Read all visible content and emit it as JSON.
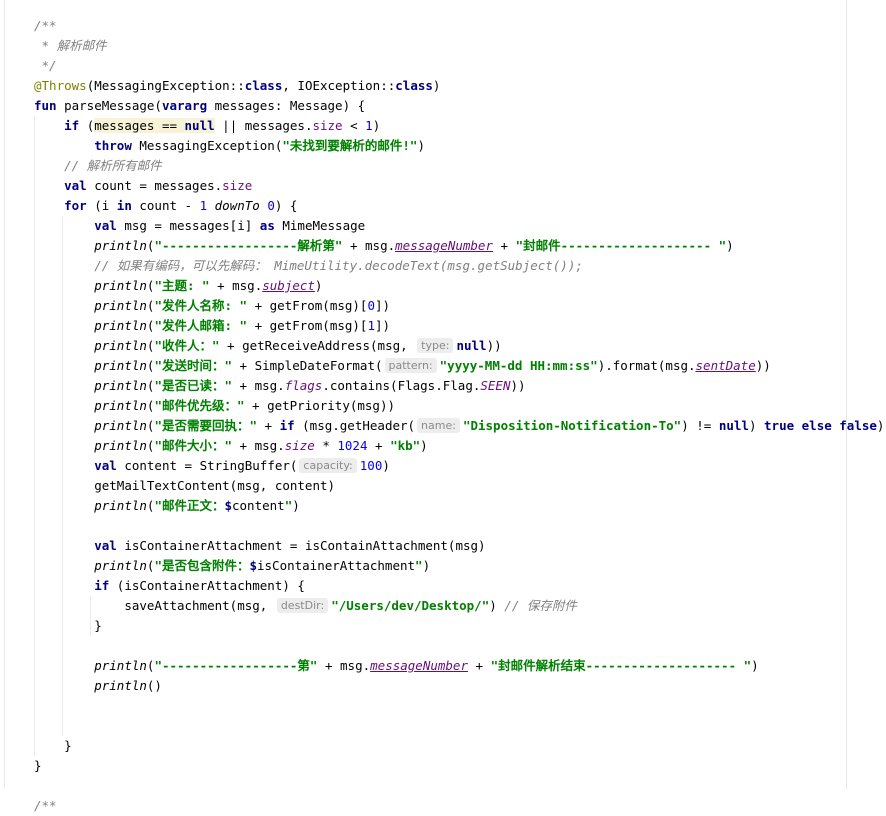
{
  "editor": {
    "lines": [
      [
        {
          "t": "/**",
          "c": "cm"
        }
      ],
      [
        {
          "t": " * 解析邮件",
          "c": "cm"
        }
      ],
      [
        {
          "t": " */",
          "c": "cm"
        }
      ],
      [
        {
          "t": "@Throws",
          "c": "ann"
        },
        {
          "t": "(MessagingException::"
        },
        {
          "t": "class",
          "c": "kw"
        },
        {
          "t": ", IOException::"
        },
        {
          "t": "class",
          "c": "kw"
        },
        {
          "t": ")"
        }
      ],
      [
        {
          "t": "fun ",
          "c": "kw"
        },
        {
          "t": "parseMessage("
        },
        {
          "t": "vararg ",
          "c": "kw"
        },
        {
          "t": "messages: Message) {"
        }
      ],
      [
        {
          "t": "    "
        },
        {
          "t": "if ",
          "c": "kw"
        },
        {
          "t": "("
        },
        {
          "t": "messages == ",
          "c": "hl"
        },
        {
          "t": "null",
          "c": "kw hl"
        },
        {
          "t": " || messages."
        },
        {
          "t": "size",
          "c": "prop"
        },
        {
          "t": " < "
        },
        {
          "t": "1",
          "c": "num"
        },
        {
          "t": ")"
        }
      ],
      [
        {
          "t": "        "
        },
        {
          "t": "throw ",
          "c": "kw"
        },
        {
          "t": "MessagingException("
        },
        {
          "t": "\"未找到要解析的邮件!\"",
          "c": "str"
        },
        {
          "t": ")"
        }
      ],
      [
        {
          "t": "    "
        },
        {
          "t": "// 解析所有邮件",
          "c": "cm"
        }
      ],
      [
        {
          "t": "    "
        },
        {
          "t": "val ",
          "c": "kw"
        },
        {
          "t": "count = messages."
        },
        {
          "t": "size",
          "c": "prop"
        }
      ],
      [
        {
          "t": "    "
        },
        {
          "t": "for ",
          "c": "kw"
        },
        {
          "t": "(i "
        },
        {
          "t": "in ",
          "c": "kw"
        },
        {
          "t": "count - "
        },
        {
          "t": "1",
          "c": "num"
        },
        {
          "t": " "
        },
        {
          "t": "downTo",
          "c": "it"
        },
        {
          "t": " "
        },
        {
          "t": "0",
          "c": "num"
        },
        {
          "t": ") {"
        }
      ],
      [
        {
          "t": "        "
        },
        {
          "t": "val ",
          "c": "kw"
        },
        {
          "t": "msg = messages[i] "
        },
        {
          "t": "as ",
          "c": "kw"
        },
        {
          "t": "MimeMessage"
        }
      ],
      [
        {
          "t": "        "
        },
        {
          "t": "println",
          "c": "it"
        },
        {
          "t": "("
        },
        {
          "t": "\"------------------解析第\"",
          "c": "str"
        },
        {
          "t": " + msg."
        },
        {
          "t": "messageNumber",
          "c": "propu"
        },
        {
          "t": " + "
        },
        {
          "t": "\"封邮件-------------------- \"",
          "c": "str"
        },
        {
          "t": ")"
        }
      ],
      [
        {
          "t": "        "
        },
        {
          "t": "// 如果有编码，可以先解码： MimeUtility.decodeText(msg.getSubject());",
          "c": "cm"
        }
      ],
      [
        {
          "t": "        "
        },
        {
          "t": "println",
          "c": "it"
        },
        {
          "t": "("
        },
        {
          "t": "\"主题: \"",
          "c": "str"
        },
        {
          "t": " + msg."
        },
        {
          "t": "subject",
          "c": "propu"
        },
        {
          "t": ")"
        }
      ],
      [
        {
          "t": "        "
        },
        {
          "t": "println",
          "c": "it"
        },
        {
          "t": "("
        },
        {
          "t": "\"发件人名称: \"",
          "c": "str"
        },
        {
          "t": " + getFrom(msg)["
        },
        {
          "t": "0",
          "c": "num"
        },
        {
          "t": "])"
        }
      ],
      [
        {
          "t": "        "
        },
        {
          "t": "println",
          "c": "it"
        },
        {
          "t": "("
        },
        {
          "t": "\"发件人邮箱: \"",
          "c": "str"
        },
        {
          "t": " + getFrom(msg)["
        },
        {
          "t": "1",
          "c": "num"
        },
        {
          "t": "])"
        }
      ],
      [
        {
          "t": "        "
        },
        {
          "t": "println",
          "c": "it"
        },
        {
          "t": "("
        },
        {
          "t": "\"收件人：\"",
          "c": "str"
        },
        {
          "t": " + getReceiveAddress(msg, "
        },
        {
          "t": "type:",
          "c": "hint"
        },
        {
          "t": "null",
          "c": "kw"
        },
        {
          "t": "))"
        }
      ],
      [
        {
          "t": "        "
        },
        {
          "t": "println",
          "c": "it"
        },
        {
          "t": "("
        },
        {
          "t": "\"发送时间：\"",
          "c": "str"
        },
        {
          "t": " + SimpleDateFormat("
        },
        {
          "t": "pattern:",
          "c": "hint"
        },
        {
          "t": "\"yyyy-MM-dd HH:mm:ss\"",
          "c": "str"
        },
        {
          "t": ").format(msg."
        },
        {
          "t": "sentDate",
          "c": "propu"
        },
        {
          "t": "))"
        }
      ],
      [
        {
          "t": "        "
        },
        {
          "t": "println",
          "c": "it"
        },
        {
          "t": "("
        },
        {
          "t": "\"是否已读：\"",
          "c": "str"
        },
        {
          "t": " + msg."
        },
        {
          "t": "flags",
          "c": "cst"
        },
        {
          "t": ".contains(Flags.Flag."
        },
        {
          "t": "SEEN",
          "c": "cst"
        },
        {
          "t": "))"
        }
      ],
      [
        {
          "t": "        "
        },
        {
          "t": "println",
          "c": "it"
        },
        {
          "t": "("
        },
        {
          "t": "\"邮件优先级：\"",
          "c": "str"
        },
        {
          "t": " + getPriority(msg))"
        }
      ],
      [
        {
          "t": "        "
        },
        {
          "t": "println",
          "c": "it"
        },
        {
          "t": "("
        },
        {
          "t": "\"是否需要回执：\"",
          "c": "str"
        },
        {
          "t": " + "
        },
        {
          "t": "if ",
          "c": "kw"
        },
        {
          "t": "(msg.getHeader("
        },
        {
          "t": "name:",
          "c": "hint"
        },
        {
          "t": "\"Disposition-Notification-To\"",
          "c": "str"
        },
        {
          "t": ") != "
        },
        {
          "t": "null",
          "c": "kw"
        },
        {
          "t": ") "
        },
        {
          "t": "true else false",
          "c": "kw"
        },
        {
          "t": ")"
        }
      ],
      [
        {
          "t": "        "
        },
        {
          "t": "println",
          "c": "it"
        },
        {
          "t": "("
        },
        {
          "t": "\"邮件大小：\"",
          "c": "str"
        },
        {
          "t": " + msg."
        },
        {
          "t": "size",
          "c": "cst"
        },
        {
          "t": " * "
        },
        {
          "t": "1024",
          "c": "num"
        },
        {
          "t": " + "
        },
        {
          "t": "\"kb\"",
          "c": "str"
        },
        {
          "t": ")"
        }
      ],
      [
        {
          "t": "        "
        },
        {
          "t": "val ",
          "c": "kw"
        },
        {
          "t": "content = StringBuffer("
        },
        {
          "t": "capacity:",
          "c": "hint"
        },
        {
          "t": "100",
          "c": "num"
        },
        {
          "t": ")"
        }
      ],
      [
        {
          "t": "        "
        },
        {
          "t": "getMailTextContent(msg, content)"
        }
      ],
      [
        {
          "t": "        "
        },
        {
          "t": "println",
          "c": "it"
        },
        {
          "t": "("
        },
        {
          "t": "\"邮件正文：",
          "c": "str"
        },
        {
          "t": "$",
          "c": "kw"
        },
        {
          "t": "content"
        },
        {
          "t": "\"",
          "c": "str"
        },
        {
          "t": ")"
        }
      ],
      [],
      [
        {
          "t": "        "
        },
        {
          "t": "val ",
          "c": "kw"
        },
        {
          "t": "isContainerAttachment = isContainAttachment(msg)"
        }
      ],
      [
        {
          "t": "        "
        },
        {
          "t": "println",
          "c": "it"
        },
        {
          "t": "("
        },
        {
          "t": "\"是否包含附件：",
          "c": "str"
        },
        {
          "t": "$",
          "c": "kw"
        },
        {
          "t": "isContainerAttachment"
        },
        {
          "t": "\"",
          "c": "str"
        },
        {
          "t": ")"
        }
      ],
      [
        {
          "t": "        "
        },
        {
          "t": "if ",
          "c": "kw"
        },
        {
          "t": "(isContainerAttachment) {"
        }
      ],
      [
        {
          "t": "            "
        },
        {
          "t": "saveAttachment(msg, "
        },
        {
          "t": "destDir:",
          "c": "hint"
        },
        {
          "t": "\"/Users/dev/Desktop/\"",
          "c": "str"
        },
        {
          "t": ") "
        },
        {
          "t": "// 保存附件",
          "c": "cm"
        }
      ],
      [
        {
          "t": "        "
        },
        {
          "t": "}"
        }
      ],
      [],
      [
        {
          "t": "        "
        },
        {
          "t": "println",
          "c": "it"
        },
        {
          "t": "("
        },
        {
          "t": "\"------------------第\"",
          "c": "str"
        },
        {
          "t": " + msg."
        },
        {
          "t": "messageNumber",
          "c": "propu"
        },
        {
          "t": " + "
        },
        {
          "t": "\"封邮件解析结束-------------------- \"",
          "c": "str"
        },
        {
          "t": ")"
        }
      ],
      [
        {
          "t": "        "
        },
        {
          "t": "println",
          "c": "it"
        },
        {
          "t": "()"
        }
      ],
      [],
      [],
      [
        {
          "t": "    "
        },
        {
          "t": "}"
        }
      ],
      [
        {
          "t": "}"
        }
      ],
      [],
      [
        {
          "t": "/**",
          "c": "cm"
        }
      ]
    ]
  }
}
